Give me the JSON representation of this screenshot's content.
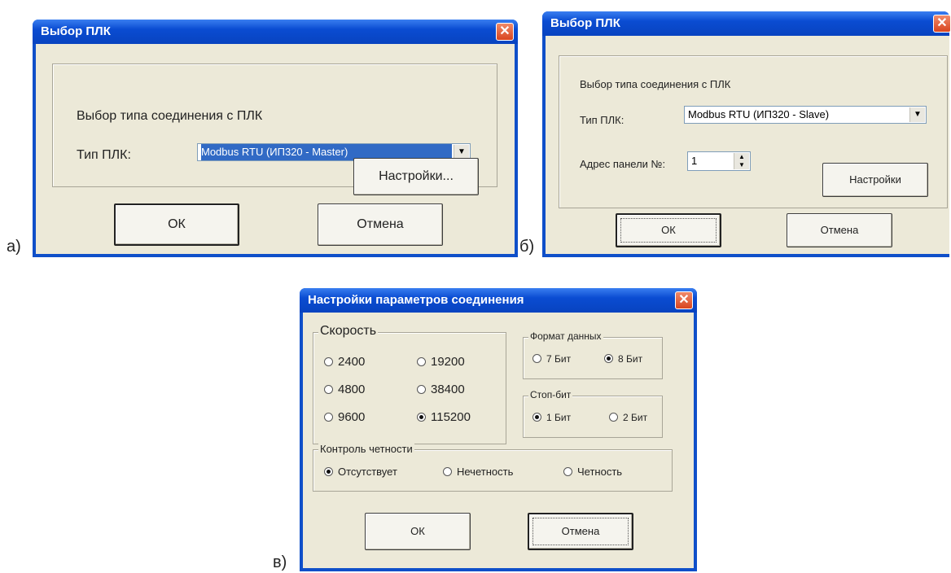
{
  "labels": {
    "a": "а)",
    "b": "б)",
    "c": "в)"
  },
  "dialog_a": {
    "title": "Выбор ПЛК",
    "close_symbol": "✕",
    "heading": "Выбор типа соединения с ПЛК",
    "plc_type_label": "Тип ПЛК:",
    "plc_type_value": "Modbus RTU (ИП320 - Master)",
    "settings_button": "Настройки...",
    "ok_button": "ОК",
    "cancel_button": "Отмена"
  },
  "dialog_b": {
    "title": "Выбор ПЛК",
    "close_symbol": "✕",
    "heading": "Выбор типа соединения с ПЛК",
    "plc_type_label": "Тип ПЛК:",
    "plc_type_value": "Modbus RTU (ИП320 - Slave)",
    "panel_address_label": "Адрес панели №:",
    "panel_address_value": "1",
    "settings_button": "Настройки",
    "ok_button": "ОК",
    "cancel_button": "Отмена"
  },
  "dialog_c": {
    "title": "Настройки параметров соединения",
    "close_symbol": "✕",
    "speed": {
      "legend": "Скорость",
      "options": [
        "2400",
        "19200",
        "4800",
        "38400",
        "9600",
        "115200"
      ],
      "selected": "115200"
    },
    "data_format": {
      "legend": "Формат данных",
      "options": [
        "7 Бит",
        "8 Бит"
      ],
      "selected": "8 Бит"
    },
    "stop_bit": {
      "legend": "Стоп-бит",
      "options": [
        "1 Бит",
        "2 Бит"
      ],
      "selected": "1 Бит"
    },
    "parity": {
      "legend": "Контроль четности",
      "options": [
        "Отсутствует",
        "Нечетность",
        "Четность"
      ],
      "selected": "Отсутствует"
    },
    "ok_button": "ОК",
    "cancel_button": "Отмена"
  },
  "colors": {
    "titlebar": "#0a4cd2",
    "dialog_bg": "#ece9d8",
    "close": "#d9451f",
    "selection": "#316ac5"
  },
  "icons": {
    "close": "close-icon",
    "combo_arrow": "chevron-down-icon",
    "spinner": "spinner-icon"
  }
}
